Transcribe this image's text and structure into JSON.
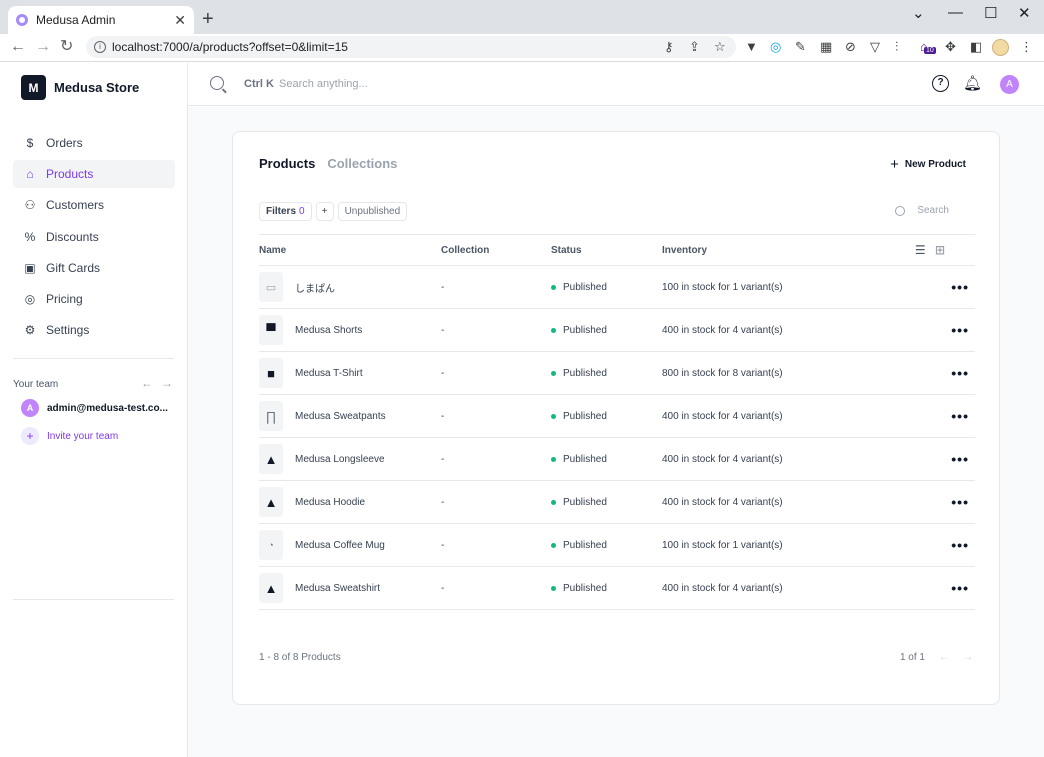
{
  "browser": {
    "tab_title": "Medusa Admin",
    "url": "localhost:7000/a/products?offset=0&limit=15",
    "extension_badge": "10"
  },
  "sidebar": {
    "store_initial": "M",
    "store_name": "Medusa Store",
    "nav": [
      {
        "label": "Orders",
        "icon": "dollar-icon",
        "glyph": "$",
        "active": false
      },
      {
        "label": "Products",
        "icon": "tag-icon",
        "glyph": "⌂",
        "active": true
      },
      {
        "label": "Customers",
        "icon": "user-icon",
        "glyph": "⚇",
        "active": false
      },
      {
        "label": "Discounts",
        "icon": "discount-icon",
        "glyph": "%",
        "active": false
      },
      {
        "label": "Gift Cards",
        "icon": "gift-icon",
        "glyph": "▣",
        "active": false
      },
      {
        "label": "Pricing",
        "icon": "pricing-icon",
        "glyph": "◎",
        "active": false
      },
      {
        "label": "Settings",
        "icon": "gear-icon",
        "glyph": "⚙",
        "active": false
      }
    ],
    "team_label": "Your team",
    "team_member": {
      "initial": "A",
      "email": "admin@medusa-test.co..."
    },
    "invite_label": "Invite your team"
  },
  "topbar": {
    "shortcut": "Ctrl K",
    "search_placeholder": "Search anything...",
    "user_initial": "A"
  },
  "products_page": {
    "tabs": [
      "Products",
      "Collections"
    ],
    "new_product_label": "New Product",
    "filters_label": "Filters",
    "filters_count": "0",
    "add_filter": "+",
    "unpublished_chip": "Unpublished",
    "search_label": "Search",
    "columns": [
      "Name",
      "Collection",
      "Status",
      "Inventory"
    ],
    "rows": [
      {
        "name": "しまぱん",
        "collection": "-",
        "status": "Published",
        "inventory": "100 in stock for 1 variant(s)",
        "thumb": "image-placeholder-icon"
      },
      {
        "name": "Medusa Shorts",
        "collection": "-",
        "status": "Published",
        "inventory": "400 in stock for 4 variant(s)",
        "thumb": "shorts-icon"
      },
      {
        "name": "Medusa T-Shirt",
        "collection": "-",
        "status": "Published",
        "inventory": "800 in stock for 8 variant(s)",
        "thumb": "tshirt-icon"
      },
      {
        "name": "Medusa Sweatpants",
        "collection": "-",
        "status": "Published",
        "inventory": "400 in stock for 4 variant(s)",
        "thumb": "sweatpants-icon"
      },
      {
        "name": "Medusa Longsleeve",
        "collection": "-",
        "status": "Published",
        "inventory": "400 in stock for 4 variant(s)",
        "thumb": "longsleeve-icon"
      },
      {
        "name": "Medusa Hoodie",
        "collection": "-",
        "status": "Published",
        "inventory": "400 in stock for 4 variant(s)",
        "thumb": "hoodie-icon"
      },
      {
        "name": "Medusa Coffee Mug",
        "collection": "-",
        "status": "Published",
        "inventory": "100 in stock for 1 variant(s)",
        "thumb": "mug-icon"
      },
      {
        "name": "Medusa Sweatshirt",
        "collection": "-",
        "status": "Published",
        "inventory": "400 in stock for 4 variant(s)",
        "thumb": "sweatshirt-icon"
      }
    ],
    "footer_count": "1 - 8 of 8 Products",
    "pagination": "1 of 1"
  },
  "colors": {
    "accent": "#7c3aed",
    "published": "#10b981"
  }
}
